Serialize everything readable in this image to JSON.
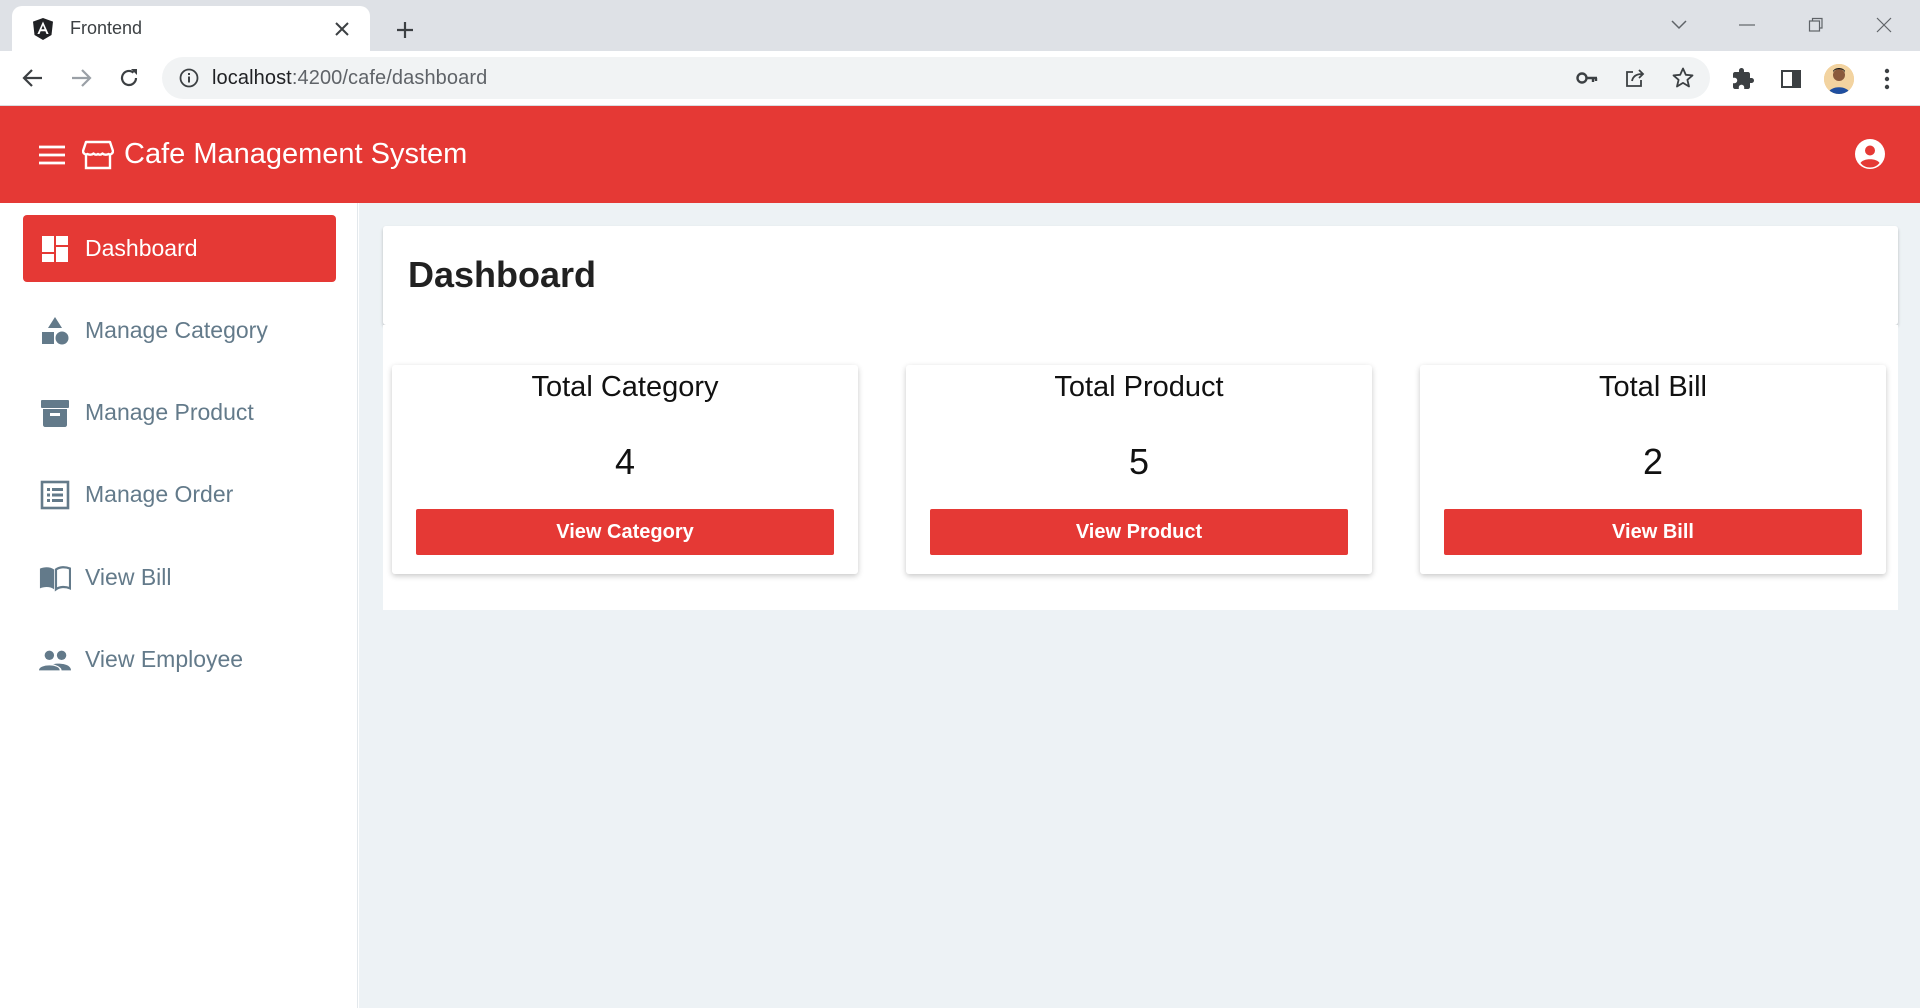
{
  "browser": {
    "tab_title": "Frontend",
    "url_host": "localhost",
    "url_rest": ":4200/cafe/dashboard"
  },
  "header": {
    "title": "Cafe Management System"
  },
  "sidebar": {
    "items": [
      {
        "label": "Dashboard",
        "icon": "dashboard-icon",
        "active": true
      },
      {
        "label": "Manage Category",
        "icon": "category-icon",
        "active": false
      },
      {
        "label": "Manage Product",
        "icon": "inventory-icon",
        "active": false
      },
      {
        "label": "Manage Order",
        "icon": "list-alt-icon",
        "active": false
      },
      {
        "label": "View Bill",
        "icon": "book-icon",
        "active": false
      },
      {
        "label": "View Employee",
        "icon": "people-icon",
        "active": false
      }
    ]
  },
  "main": {
    "page_title": "Dashboard",
    "cards": [
      {
        "label": "Total Category",
        "value": "4",
        "button": "View Category"
      },
      {
        "label": "Total Product",
        "value": "5",
        "button": "View Product"
      },
      {
        "label": "Total Bill",
        "value": "2",
        "button": "View Bill"
      }
    ]
  },
  "colors": {
    "accent": "#e53935",
    "sidebar_text": "#637a8a",
    "content_bg": "#edf2f5"
  }
}
